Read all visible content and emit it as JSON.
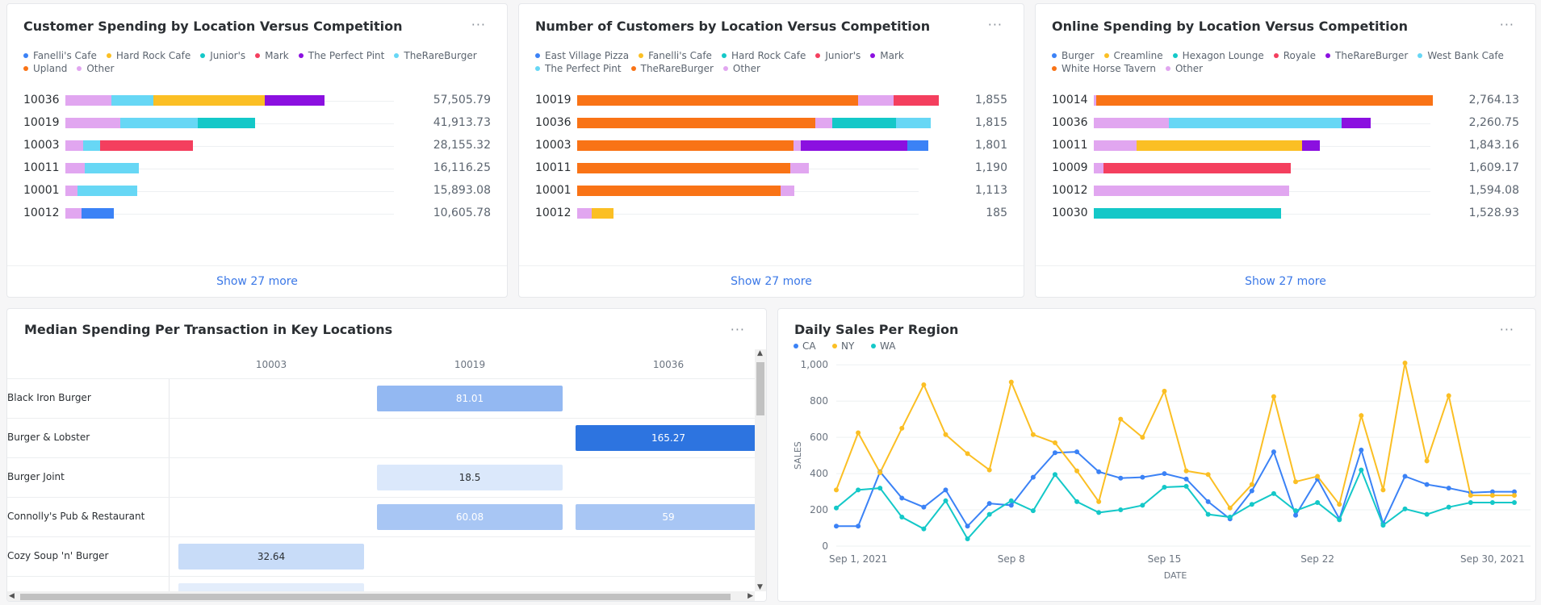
{
  "cards": {
    "spending": {
      "title": "Customer Spending by Location Versus Competition",
      "more": "···",
      "show_more": "Show 27 more",
      "legend": [
        {
          "name": "Fanelli's Cafe",
          "color": "#3b82f6"
        },
        {
          "name": "Hard Rock Cafe",
          "color": "#fbbf24"
        },
        {
          "name": "Junior's",
          "color": "#14c8c8"
        },
        {
          "name": "Mark",
          "color": "#f43f5e"
        },
        {
          "name": "The Perfect Pint",
          "color": "#8b10e0"
        },
        {
          "name": "TheRareBurger",
          "color": "#67d7f5"
        },
        {
          "name": "Upland",
          "color": "#f97316"
        },
        {
          "name": "Other",
          "color": "#e1a6f0"
        }
      ],
      "rows": [
        {
          "label": "10036",
          "value": "57,505.79",
          "segments": [
            {
              "c": "#e1a6f0",
              "v": 7600
            },
            {
              "c": "#67d7f5",
              "v": 7100
            },
            {
              "c": "#fbbf24",
              "v": 18500
            },
            {
              "c": "#8b10e0",
              "v": 9900
            }
          ]
        },
        {
          "label": "10019",
          "value": "41,913.73",
          "segments": [
            {
              "c": "#e1a6f0",
              "v": 9200
            },
            {
              "c": "#67d7f5",
              "v": 12800
            },
            {
              "c": "#14c8c8",
              "v": 9600
            }
          ]
        },
        {
          "label": "10003",
          "value": "28,155.32",
          "segments": [
            {
              "c": "#e1a6f0",
              "v": 2900
            },
            {
              "c": "#67d7f5",
              "v": 2900
            },
            {
              "c": "#f43f5e",
              "v": 15400
            }
          ]
        },
        {
          "label": "10011",
          "value": "16,116.25",
          "segments": [
            {
              "c": "#e1a6f0",
              "v": 3200
            },
            {
              "c": "#67d7f5",
              "v": 9000
            }
          ]
        },
        {
          "label": "10001",
          "value": "15,893.08",
          "segments": [
            {
              "c": "#e1a6f0",
              "v": 2000
            },
            {
              "c": "#67d7f5",
              "v": 10000
            }
          ]
        },
        {
          "label": "10012",
          "value": "10,605.78",
          "segments": [
            {
              "c": "#e1a6f0",
              "v": 2700
            },
            {
              "c": "#3b82f6",
              "v": 5300
            }
          ]
        }
      ],
      "max": 57505.79
    },
    "customers": {
      "title": "Number of Customers by Location Versus Competition",
      "more": "···",
      "show_more": "Show 27 more",
      "legend": [
        {
          "name": "East Village Pizza",
          "color": "#3b82f6"
        },
        {
          "name": "Fanelli's Cafe",
          "color": "#fbbf24"
        },
        {
          "name": "Hard Rock Cafe",
          "color": "#14c8c8"
        },
        {
          "name": "Junior's",
          "color": "#f43f5e"
        },
        {
          "name": "Mark",
          "color": "#8b10e0"
        },
        {
          "name": "The Perfect Pint",
          "color": "#67d7f5"
        },
        {
          "name": "TheRareBurger",
          "color": "#f97316"
        },
        {
          "name": "Other",
          "color": "#e1a6f0"
        }
      ],
      "rows": [
        {
          "label": "10019",
          "value": "1,855",
          "segments": [
            {
              "c": "#f97316",
              "v": 1440
            },
            {
              "c": "#e1a6f0",
              "v": 185
            },
            {
              "c": "#f43f5e",
              "v": 230
            }
          ]
        },
        {
          "label": "10036",
          "value": "1,815",
          "segments": [
            {
              "c": "#f97316",
              "v": 1220
            },
            {
              "c": "#e1a6f0",
              "v": 90
            },
            {
              "c": "#14c8c8",
              "v": 325
            },
            {
              "c": "#67d7f5",
              "v": 180
            }
          ]
        },
        {
          "label": "10003",
          "value": "1,801",
          "segments": [
            {
              "c": "#f97316",
              "v": 1110
            },
            {
              "c": "#e1a6f0",
              "v": 35
            },
            {
              "c": "#8b10e0",
              "v": 550
            },
            {
              "c": "#3b82f6",
              "v": 106
            }
          ]
        },
        {
          "label": "10011",
          "value": "1,190",
          "segments": [
            {
              "c": "#f97316",
              "v": 1095
            },
            {
              "c": "#e1a6f0",
              "v": 95
            }
          ]
        },
        {
          "label": "10001",
          "value": "1,113",
          "segments": [
            {
              "c": "#f97316",
              "v": 1045
            },
            {
              "c": "#e1a6f0",
              "v": 68
            }
          ]
        },
        {
          "label": "10012",
          "value": "185",
          "segments": [
            {
              "c": "#e1a6f0",
              "v": 75
            },
            {
              "c": "#fbbf24",
              "v": 110
            }
          ]
        }
      ],
      "max": 1855
    },
    "online": {
      "title": "Online Spending by Location Versus Competition",
      "more": "···",
      "show_more": "Show 27 more",
      "legend": [
        {
          "name": "Burger",
          "color": "#3b82f6"
        },
        {
          "name": "Creamline",
          "color": "#fbbf24"
        },
        {
          "name": "Hexagon Lounge",
          "color": "#14c8c8"
        },
        {
          "name": "Royale",
          "color": "#f43f5e"
        },
        {
          "name": "TheRareBurger",
          "color": "#8b10e0"
        },
        {
          "name": "West Bank Cafe",
          "color": "#67d7f5"
        },
        {
          "name": "White Horse Tavern",
          "color": "#f97316"
        },
        {
          "name": "Other",
          "color": "#e1a6f0"
        }
      ],
      "rows": [
        {
          "label": "10014",
          "value": "2,764.13",
          "segments": [
            {
              "c": "#e1a6f0",
              "v": 20
            },
            {
              "c": "#f97316",
              "v": 2744
            }
          ]
        },
        {
          "label": "10036",
          "value": "2,260.75",
          "segments": [
            {
              "c": "#e1a6f0",
              "v": 610
            },
            {
              "c": "#67d7f5",
              "v": 1410
            },
            {
              "c": "#8b10e0",
              "v": 240
            }
          ]
        },
        {
          "label": "10011",
          "value": "1,843.16",
          "segments": [
            {
              "c": "#e1a6f0",
              "v": 350
            },
            {
              "c": "#fbbf24",
              "v": 1350
            },
            {
              "c": "#8b10e0",
              "v": 143
            }
          ]
        },
        {
          "label": "10009",
          "value": "1,609.17",
          "segments": [
            {
              "c": "#e1a6f0",
              "v": 80
            },
            {
              "c": "#f43f5e",
              "v": 1529
            }
          ]
        },
        {
          "label": "10012",
          "value": "1,594.08",
          "segments": [
            {
              "c": "#e1a6f0",
              "v": 1594
            }
          ]
        },
        {
          "label": "10030",
          "value": "1,528.93",
          "segments": [
            {
              "c": "#14c8c8",
              "v": 1529
            }
          ]
        }
      ],
      "max": 2764.13
    },
    "median": {
      "title": "Median Spending Per Transaction in Key Locations",
      "more": "···",
      "columns": [
        "10003",
        "10019",
        "10036"
      ],
      "rows": [
        {
          "label": "Black Iron Burger",
          "cells": [
            null,
            {
              "v": "81.01",
              "bg": "#93b8f2",
              "fg": "#ffffff"
            },
            null
          ]
        },
        {
          "label": "Burger & Lobster",
          "cells": [
            null,
            null,
            {
              "v": "165.27",
              "bg": "#2d74e0",
              "fg": "#ffffff"
            }
          ]
        },
        {
          "label": "Burger Joint",
          "cells": [
            null,
            {
              "v": "18.5",
              "bg": "#dbe8fb",
              "fg": "#2b2f33"
            },
            null
          ]
        },
        {
          "label": "Connolly's Pub & Restaurant",
          "cells": [
            null,
            {
              "v": "60.08",
              "bg": "#a8c6f4",
              "fg": "#ffffff"
            },
            {
              "v": "59",
              "bg": "#a8c6f4",
              "fg": "#ffffff"
            }
          ]
        },
        {
          "label": "Cozy Soup 'n' Burger",
          "cells": [
            {
              "v": "32.64",
              "bg": "#c8dcf8",
              "fg": "#2b2f33"
            },
            null,
            null
          ]
        }
      ]
    },
    "daily": {
      "title": "Daily Sales Per Region",
      "more": "···"
    }
  },
  "chart_data": {
    "type": "line",
    "title": "Daily Sales Per Region",
    "xlabel": "DATE",
    "ylabel": "SALES",
    "ylim": [
      0,
      1050
    ],
    "yticks": [
      0,
      200,
      400,
      600,
      800,
      "1,000"
    ],
    "xticks": [
      "Sep 1, 2021",
      "Sep 8",
      "Sep 15",
      "Sep 22",
      "Sep 30, 2021"
    ],
    "x": [
      "2021-08-31",
      "2021-09-01",
      "2021-09-02",
      "2021-09-03",
      "2021-09-04",
      "2021-09-05",
      "2021-09-06",
      "2021-09-07",
      "2021-09-08",
      "2021-09-09",
      "2021-09-10",
      "2021-09-11",
      "2021-09-12",
      "2021-09-13",
      "2021-09-14",
      "2021-09-15",
      "2021-09-16",
      "2021-09-17",
      "2021-09-18",
      "2021-09-19",
      "2021-09-20",
      "2021-09-21",
      "2021-09-22",
      "2021-09-23",
      "2021-09-24",
      "2021-09-25",
      "2021-09-26",
      "2021-09-27",
      "2021-09-28",
      "2021-09-29",
      "2021-09-30",
      "2021-10-01"
    ],
    "series": [
      {
        "name": "CA",
        "color": "#3b82f6",
        "values": [
          110,
          110,
          410,
          265,
          215,
          310,
          110,
          235,
          225,
          380,
          515,
          520,
          410,
          375,
          380,
          400,
          370,
          245,
          150,
          305,
          520,
          170,
          370,
          150,
          530,
          125,
          385,
          340,
          320,
          295,
          300,
          300
        ]
      },
      {
        "name": "NY",
        "color": "#fbbf24",
        "values": [
          310,
          625,
          405,
          650,
          890,
          615,
          510,
          420,
          905,
          615,
          570,
          415,
          245,
          700,
          600,
          855,
          415,
          395,
          210,
          340,
          825,
          355,
          385,
          230,
          720,
          310,
          1010,
          470,
          830,
          280,
          280,
          280
        ]
      },
      {
        "name": "WA",
        "color": "#14c8c8",
        "values": [
          210,
          310,
          320,
          160,
          95,
          250,
          40,
          175,
          250,
          195,
          395,
          245,
          185,
          200,
          225,
          325,
          330,
          175,
          160,
          230,
          290,
          195,
          240,
          145,
          420,
          115,
          205,
          175,
          215,
          240,
          240,
          240
        ]
      }
    ]
  }
}
